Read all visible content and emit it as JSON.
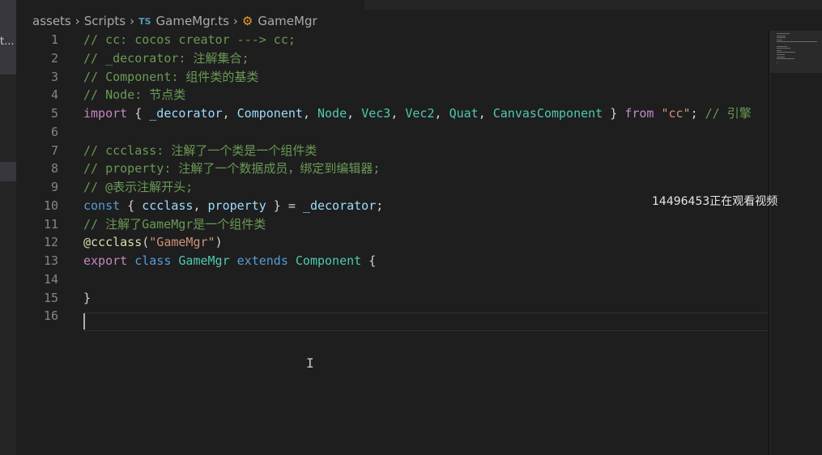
{
  "sidebar": {
    "tab_label": "t..."
  },
  "breadcrumb": {
    "items": [
      "assets",
      "Scripts",
      "GameMgr.ts",
      "GameMgr"
    ],
    "ts_badge": "TS"
  },
  "editor": {
    "lines": [
      {
        "n": "1",
        "tokens": [
          {
            "t": "// cc: cocos creator ---> cc;",
            "c": "c-com"
          }
        ]
      },
      {
        "n": "2",
        "tokens": [
          {
            "t": "// _decorator: 注解集合;",
            "c": "c-com"
          }
        ]
      },
      {
        "n": "3",
        "tokens": [
          {
            "t": "// Component: 组件类的基类",
            "c": "c-com"
          }
        ]
      },
      {
        "n": "4",
        "tokens": [
          {
            "t": "// Node: 节点类",
            "c": "c-com"
          }
        ]
      },
      {
        "n": "5",
        "tokens": [
          {
            "t": "import",
            "c": "c-kw"
          },
          {
            "t": " { ",
            "c": "c-pl"
          },
          {
            "t": "_decorator",
            "c": "c-id"
          },
          {
            "t": ", ",
            "c": "c-pl"
          },
          {
            "t": "Component",
            "c": "c-id"
          },
          {
            "t": ", ",
            "c": "c-pl"
          },
          {
            "t": "Node",
            "c": "c-cls"
          },
          {
            "t": ", ",
            "c": "c-pl"
          },
          {
            "t": "Vec3",
            "c": "c-cls"
          },
          {
            "t": ", ",
            "c": "c-pl"
          },
          {
            "t": "Vec2",
            "c": "c-cls"
          },
          {
            "t": ", ",
            "c": "c-pl"
          },
          {
            "t": "Quat",
            "c": "c-cls"
          },
          {
            "t": ", ",
            "c": "c-pl"
          },
          {
            "t": "CanvasComponent",
            "c": "c-cls"
          },
          {
            "t": " } ",
            "c": "c-pl"
          },
          {
            "t": "from",
            "c": "c-kw"
          },
          {
            "t": " ",
            "c": "c-pl"
          },
          {
            "t": "\"cc\"",
            "c": "c-str"
          },
          {
            "t": "; ",
            "c": "c-pl"
          },
          {
            "t": "// 引擎",
            "c": "c-com"
          }
        ]
      },
      {
        "n": "6",
        "tokens": []
      },
      {
        "n": "7",
        "tokens": [
          {
            "t": "// ccclass: 注解了一个类是一个组件类",
            "c": "c-com"
          }
        ]
      },
      {
        "n": "8",
        "tokens": [
          {
            "t": "// property: 注解了一个数据成员，绑定到编辑器;",
            "c": "c-com"
          }
        ]
      },
      {
        "n": "9",
        "tokens": [
          {
            "t": "// @表示注解开头;",
            "c": "c-com"
          }
        ]
      },
      {
        "n": "10",
        "tokens": [
          {
            "t": "const",
            "c": "c-kw2"
          },
          {
            "t": " { ",
            "c": "c-pl"
          },
          {
            "t": "ccclass",
            "c": "c-id"
          },
          {
            "t": ", ",
            "c": "c-pl"
          },
          {
            "t": "property",
            "c": "c-id"
          },
          {
            "t": " } = ",
            "c": "c-pl"
          },
          {
            "t": "_decorator",
            "c": "c-id"
          },
          {
            "t": ";",
            "c": "c-pl"
          }
        ]
      },
      {
        "n": "11",
        "tokens": [
          {
            "t": "// 注解了GameMgr是一个组件类",
            "c": "c-com"
          }
        ]
      },
      {
        "n": "12",
        "tokens": [
          {
            "t": "@ccclass",
            "c": "c-dec"
          },
          {
            "t": "(",
            "c": "c-pl"
          },
          {
            "t": "\"GameMgr\"",
            "c": "c-str"
          },
          {
            "t": ")",
            "c": "c-pl"
          }
        ]
      },
      {
        "n": "13",
        "tokens": [
          {
            "t": "export",
            "c": "c-kw"
          },
          {
            "t": " ",
            "c": "c-pl"
          },
          {
            "t": "class",
            "c": "c-kw2"
          },
          {
            "t": " ",
            "c": "c-pl"
          },
          {
            "t": "GameMgr",
            "c": "c-cls"
          },
          {
            "t": " ",
            "c": "c-pl"
          },
          {
            "t": "extends",
            "c": "c-kw2"
          },
          {
            "t": " ",
            "c": "c-pl"
          },
          {
            "t": "Component",
            "c": "c-cls"
          },
          {
            "t": " {",
            "c": "c-pl"
          }
        ]
      },
      {
        "n": "14",
        "tokens": []
      },
      {
        "n": "15",
        "tokens": [
          {
            "t": "}",
            "c": "c-pl"
          }
        ]
      },
      {
        "n": "16",
        "tokens": []
      }
    ]
  },
  "overlay": {
    "viewer_text": "14496453正在观看视频"
  },
  "cursor": {
    "glyph": "I"
  },
  "colors": {
    "background": "#1e1e1e",
    "comment": "#6a9955",
    "keyword": "#c586c0",
    "keyword_blue": "#569cd6",
    "identifier": "#9cdcfe",
    "class": "#4ec9b0",
    "string": "#ce9178"
  }
}
